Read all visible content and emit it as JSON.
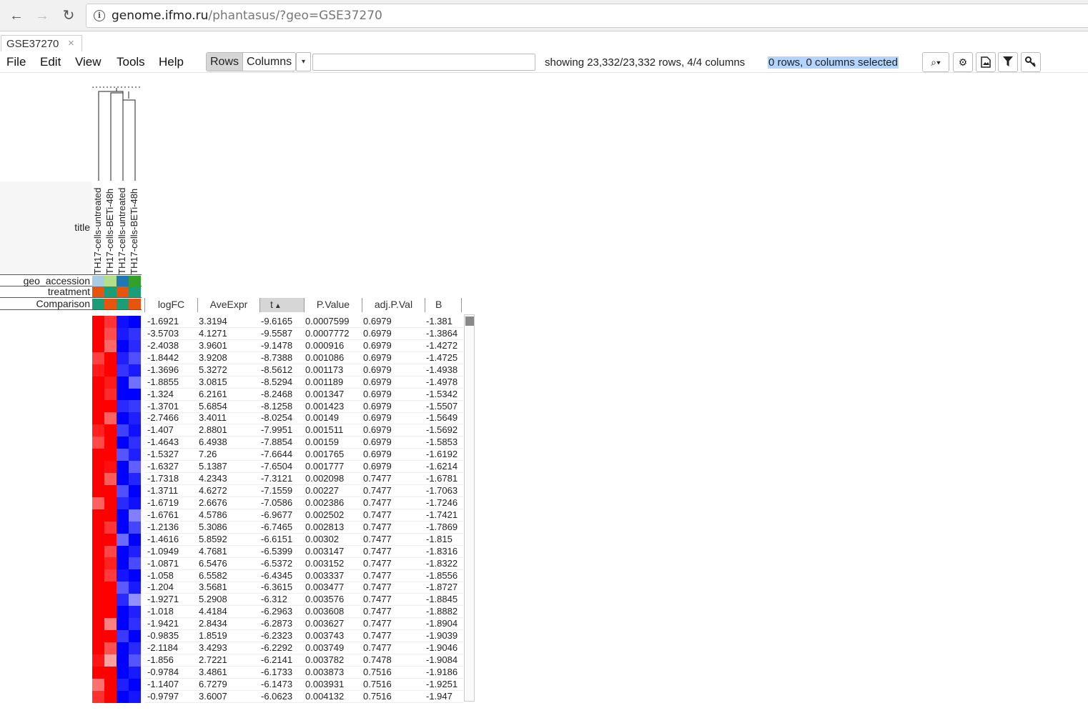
{
  "browser": {
    "back_icon": "←",
    "forward_icon": "→",
    "reload_icon": "↻",
    "url_host": "genome.ifmo.ru",
    "url_path": "/phantasus/?geo=GSE37270"
  },
  "tab": {
    "label": "GSE37270",
    "close": "×"
  },
  "menu": {
    "file": "File",
    "edit": "Edit",
    "view": "View",
    "tools": "Tools",
    "help": "Help"
  },
  "toolbar": {
    "rows_label": "Rows",
    "columns_label": "Columns",
    "dropdown_icon": "▾",
    "search_value": "",
    "status": "showing 23,332/23,332 rows, 4/4 columns",
    "selected": "0 rows, 0 columns selected",
    "zoom_icon": "⌕▾",
    "settings_icon": "⚙",
    "export_icon": "🖺",
    "filter_icon": "⛛",
    "key_icon": "🔑"
  },
  "annotations": {
    "title_label": "title",
    "geo_label": "geo_accession",
    "treatment_label": "treatment",
    "comparison_label": "Comparison",
    "column_titles": [
      "TH17-cells-untreated",
      "TH17-cells-BETi-48h",
      "TH17-cells-untreated",
      "TH17-cells-BETi-48h"
    ],
    "geo_colors": [
      "#a6cee3",
      "#b2df8a",
      "#1f78b4",
      "#33a02c"
    ],
    "treatment_colors": [
      "#e6550d",
      "#1b9e77",
      "#e6550d",
      "#1b9e77"
    ],
    "comparison_colors": [
      "#1b9e77",
      "#e6550d",
      "#1b9e77",
      "#e6550d"
    ]
  },
  "table": {
    "columns": [
      "logFC",
      "AveExpr",
      "t",
      "P.Value",
      "adj.P.Val",
      "B"
    ],
    "sort_indicator": "▲",
    "rows": [
      [
        "-1.6921",
        "3.3194",
        "-9.6165",
        "0.0007599",
        "0.6979",
        "-1.381"
      ],
      [
        "-3.5703",
        "4.1271",
        "-9.5587",
        "0.0007772",
        "0.6979",
        "-1.3864"
      ],
      [
        "-2.4038",
        "3.9601",
        "-9.1478",
        "0.000916",
        "0.6979",
        "-1.4272"
      ],
      [
        "-1.8442",
        "3.9208",
        "-8.7388",
        "0.001086",
        "0.6979",
        "-1.4725"
      ],
      [
        "-1.3696",
        "5.3272",
        "-8.5612",
        "0.001173",
        "0.6979",
        "-1.4938"
      ],
      [
        "-1.8855",
        "3.0815",
        "-8.5294",
        "0.001189",
        "0.6979",
        "-1.4978"
      ],
      [
        "-1.324",
        "6.2161",
        "-8.2468",
        "0.001347",
        "0.6979",
        "-1.5342"
      ],
      [
        "-1.3701",
        "5.6854",
        "-8.1258",
        "0.001423",
        "0.6979",
        "-1.5507"
      ],
      [
        "-2.7466",
        "3.4011",
        "-8.0254",
        "0.00149",
        "0.6979",
        "-1.5649"
      ],
      [
        "-1.407",
        "2.8801",
        "-7.9951",
        "0.001511",
        "0.6979",
        "-1.5692"
      ],
      [
        "-1.4643",
        "6.4938",
        "-7.8854",
        "0.00159",
        "0.6979",
        "-1.5853"
      ],
      [
        "-1.5327",
        "7.26",
        "-7.6644",
        "0.001765",
        "0.6979",
        "-1.6192"
      ],
      [
        "-1.6327",
        "5.1387",
        "-7.6504",
        "0.001777",
        "0.6979",
        "-1.6214"
      ],
      [
        "-1.7318",
        "4.2343",
        "-7.3121",
        "0.002098",
        "0.7477",
        "-1.6781"
      ],
      [
        "-1.3711",
        "4.6272",
        "-7.1559",
        "0.00227",
        "0.7477",
        "-1.7063"
      ],
      [
        "-1.6719",
        "2.6676",
        "-7.0586",
        "0.002386",
        "0.7477",
        "-1.7246"
      ],
      [
        "-1.6761",
        "4.5786",
        "-6.9677",
        "0.002502",
        "0.7477",
        "-1.7421"
      ],
      [
        "-1.2136",
        "5.3086",
        "-6.7465",
        "0.002813",
        "0.7477",
        "-1.7869"
      ],
      [
        "-1.4616",
        "5.8592",
        "-6.6151",
        "0.00302",
        "0.7477",
        "-1.815"
      ],
      [
        "-1.0949",
        "4.7681",
        "-6.5399",
        "0.003147",
        "0.7477",
        "-1.8316"
      ],
      [
        "-1.0871",
        "6.5476",
        "-6.5372",
        "0.003152",
        "0.7477",
        "-1.8322"
      ],
      [
        "-1.058",
        "6.5582",
        "-6.4345",
        "0.003337",
        "0.7477",
        "-1.8556"
      ],
      [
        "-1.204",
        "3.5681",
        "-6.3615",
        "0.003477",
        "0.7477",
        "-1.8727"
      ],
      [
        "-1.9271",
        "5.2908",
        "-6.312",
        "0.003576",
        "0.7477",
        "-1.8845"
      ],
      [
        "-1.018",
        "4.4184",
        "-6.2963",
        "0.003608",
        "0.7477",
        "-1.8882"
      ],
      [
        "-1.9421",
        "2.8434",
        "-6.2873",
        "0.003627",
        "0.7477",
        "-1.8904"
      ],
      [
        "-0.9835",
        "1.8519",
        "-6.2323",
        "0.003743",
        "0.7477",
        "-1.9039"
      ],
      [
        "-2.1184",
        "3.4293",
        "-6.2292",
        "0.003749",
        "0.7477",
        "-1.9046"
      ],
      [
        "-1.856",
        "2.7221",
        "-6.2141",
        "0.003782",
        "0.7478",
        "-1.9084"
      ],
      [
        "-0.9784",
        "3.4861",
        "-6.1733",
        "0.003873",
        "0.7516",
        "-1.9186"
      ],
      [
        "-1.1407",
        "6.7279",
        "-6.1473",
        "0.003931",
        "0.7516",
        "-1.9251"
      ],
      [
        "-0.9797",
        "3.6007",
        "-6.0623",
        "0.004132",
        "0.7516",
        "-1.947"
      ]
    ]
  },
  "heatmap": {
    "rows": [
      [
        "#ff0000",
        "#ff3333",
        "#1010ff",
        "#0000ff"
      ],
      [
        "#ff0000",
        "#ff4d4d",
        "#1a1aff",
        "#3333ff"
      ],
      [
        "#ff0000",
        "#ff6666",
        "#0000ff",
        "#2a2aff"
      ],
      [
        "#ff4040",
        "#ff0000",
        "#2020ff",
        "#5050ff"
      ],
      [
        "#ff1a1a",
        "#ff0000",
        "#3535ff",
        "#1a1aff"
      ],
      [
        "#ff0000",
        "#ff1a1a",
        "#0000ff",
        "#7070ff"
      ],
      [
        "#ff0000",
        "#ff2a2a",
        "#0000ff",
        "#0000ff"
      ],
      [
        "#ff0000",
        "#ff0000",
        "#2a2aff",
        "#3a3aff"
      ],
      [
        "#ff0000",
        "#ff6060",
        "#0000ff",
        "#2020ff"
      ],
      [
        "#ff2020",
        "#ff0000",
        "#4040ff",
        "#1010ff"
      ],
      [
        "#ff4a4a",
        "#ff0000",
        "#0000ff",
        "#3030ff"
      ],
      [
        "#ff0000",
        "#ff0000",
        "#5555ff",
        "#2020ff"
      ],
      [
        "#ff0000",
        "#ff1010",
        "#0000ff",
        "#6060ff"
      ],
      [
        "#ff0000",
        "#ff5a5a",
        "#0000ff",
        "#2525ff"
      ],
      [
        "#ff0000",
        "#ff0000",
        "#5050ff",
        "#0000ff"
      ],
      [
        "#ff6060",
        "#ff0000",
        "#2a2aff",
        "#1010ff"
      ],
      [
        "#ff0000",
        "#ff0000",
        "#0000ff",
        "#8080ff"
      ],
      [
        "#ff0000",
        "#ff3535",
        "#0000ff",
        "#4545ff"
      ],
      [
        "#ff0000",
        "#ff0000",
        "#6a6aff",
        "#0000ff"
      ],
      [
        "#ff0000",
        "#ff4545",
        "#0000ff",
        "#2020ff"
      ],
      [
        "#ff0000",
        "#ff2020",
        "#0000ff",
        "#4a4aff"
      ],
      [
        "#ff0000",
        "#ff3a3a",
        "#1515ff",
        "#0000ff"
      ],
      [
        "#ff0000",
        "#ff0000",
        "#5a5aff",
        "#1a1aff"
      ],
      [
        "#ff0000",
        "#ff0000",
        "#2a2aff",
        "#9090ff"
      ],
      [
        "#ff0000",
        "#ff0000",
        "#0000ff",
        "#2020ff"
      ],
      [
        "#ff0000",
        "#ff8080",
        "#0000ff",
        "#3030ff"
      ],
      [
        "#ff0000",
        "#ff0000",
        "#3a3aff",
        "#0000ff"
      ],
      [
        "#ff0000",
        "#ff5050",
        "#0000ff",
        "#2a2aff"
      ],
      [
        "#ff1515",
        "#ffa0a0",
        "#0000ff",
        "#5555ff"
      ],
      [
        "#ff0000",
        "#ff0000",
        "#0000ff",
        "#1a1aff"
      ],
      [
        "#ff7070",
        "#ff0000",
        "#2020ff",
        "#0000ff"
      ],
      [
        "#ff3030",
        "#ff0000",
        "#0000ff",
        "#1515ff"
      ]
    ]
  }
}
